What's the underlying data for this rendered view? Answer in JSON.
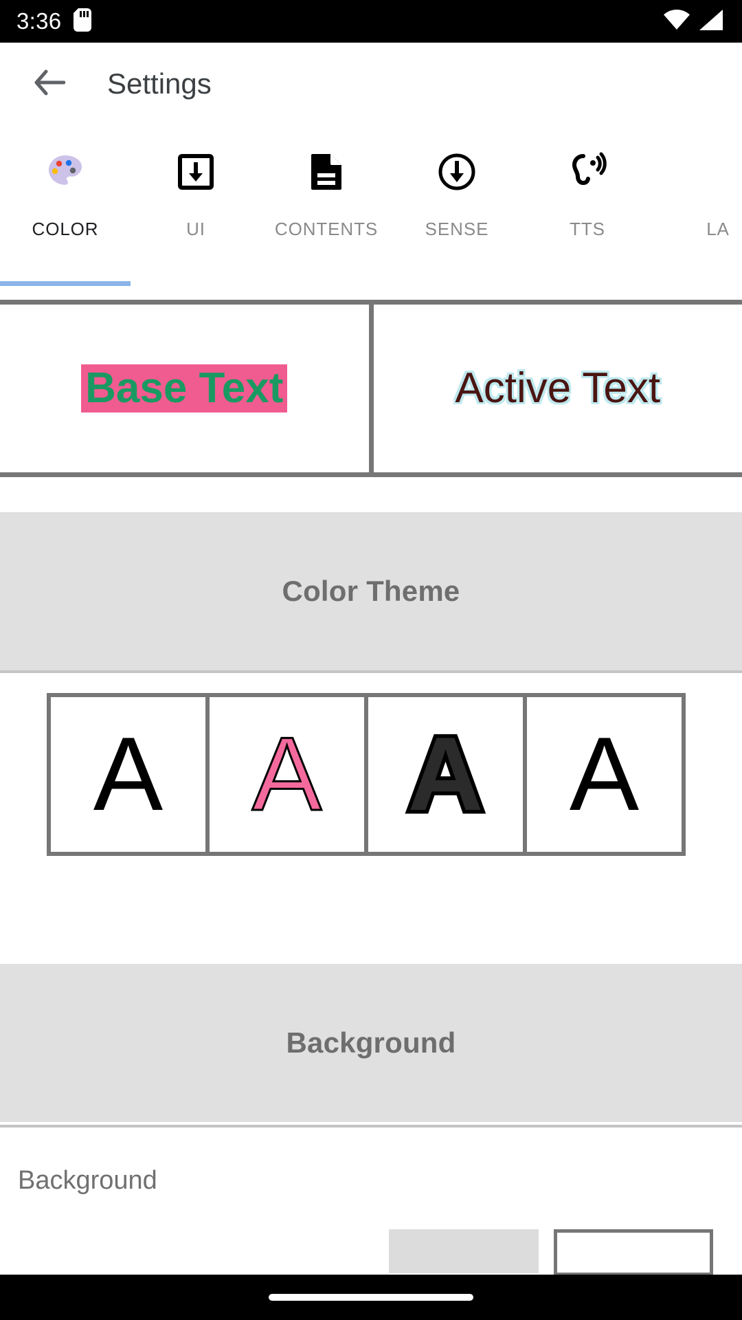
{
  "status_bar": {
    "time": "3:36",
    "icons": [
      "sd-card-icon",
      "wifi-icon",
      "cellular-signal-icon"
    ]
  },
  "app_bar": {
    "back_icon": "back-arrow-icon",
    "title": "Settings"
  },
  "tabs": {
    "active_index": 0,
    "items": [
      {
        "label": "COLOR",
        "icon": "palette-icon"
      },
      {
        "label": "UI",
        "icon": "download-box-icon"
      },
      {
        "label": "CONTENTS",
        "icon": "document-icon"
      },
      {
        "label": "SENSE",
        "icon": "circle-down-arrow-icon"
      },
      {
        "label": "TTS",
        "icon": "hearing-icon"
      },
      {
        "label": "LA",
        "icon": "language-icon"
      }
    ]
  },
  "preview": {
    "base_text": "Base Text",
    "active_text": "Active Text",
    "base_text_color": "#1a9a62",
    "base_highlight_color": "#f05b90",
    "active_text_color": "#4a1512",
    "active_outline_color": "#bfe9ee"
  },
  "sections": {
    "color_theme": {
      "header": "Color Theme",
      "swatches": [
        {
          "glyph": "A",
          "style": "plain"
        },
        {
          "glyph": "A",
          "style": "pink"
        },
        {
          "glyph": "A",
          "style": "bold"
        },
        {
          "glyph": "A",
          "style": "thin"
        }
      ]
    },
    "background": {
      "header": "Background",
      "row_label": "Background"
    }
  },
  "colors": {
    "accent_indicator": "#8ab4e8",
    "section_band": "#e0e0e0",
    "section_text": "#6e6e6e",
    "frame_border": "#767676"
  },
  "nav_bar": {
    "gesture_pill": "home-gesture-pill"
  }
}
